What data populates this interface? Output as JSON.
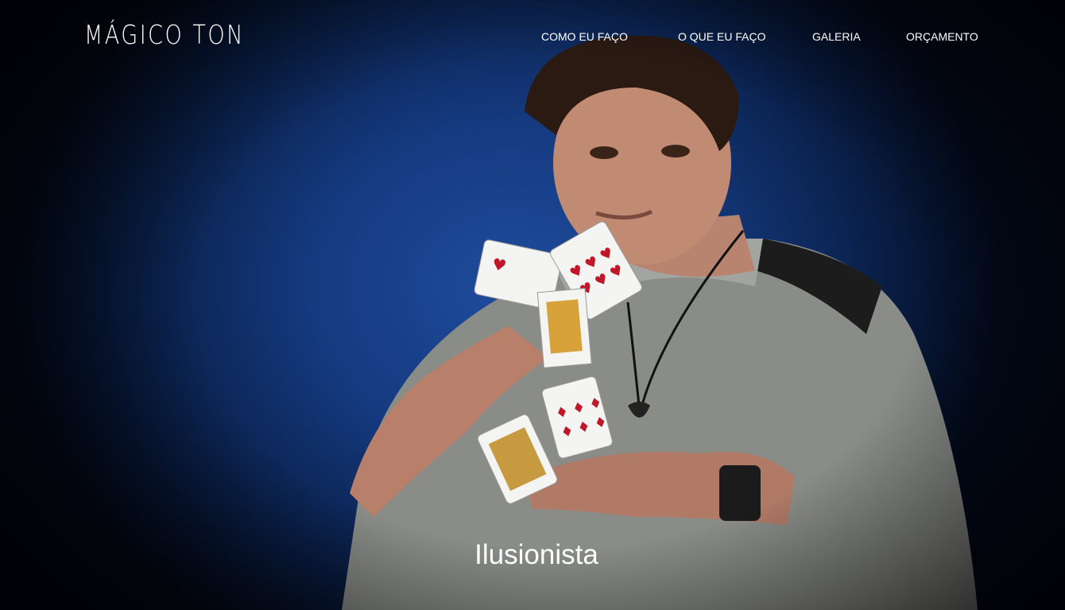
{
  "brand": {
    "logo_text": "MÁGICO TON"
  },
  "nav": {
    "items": [
      {
        "label": "COMO EU FAÇO"
      },
      {
        "label": "O QUE EU FAÇO"
      },
      {
        "label": "GALERIA"
      },
      {
        "label": "ORÇAMENTO"
      }
    ]
  },
  "hero": {
    "caption": "Ilusionista",
    "background_color": "#153a80",
    "image_subject": "magician-holding-playing-cards-photo"
  }
}
